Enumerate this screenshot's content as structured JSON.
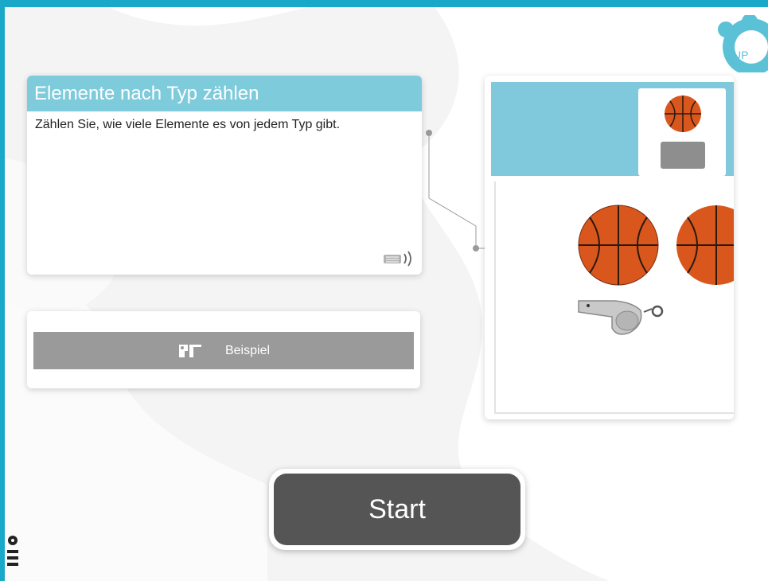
{
  "task": {
    "title": "Elemente nach Typ zählen",
    "description": "Zählen Sie, wie viele Elemente es von jedem Typ gibt."
  },
  "example_button": {
    "label": "Beispiel"
  },
  "start_button": {
    "label": "Start"
  },
  "brand_logo": {
    "text": "UP"
  },
  "colors": {
    "frame": "#1aa8c8",
    "title_bar": "#7ecbdc",
    "example_button": "#9a9a9a",
    "start_button": "#555555",
    "ball": "#d9571c"
  },
  "icons": {
    "audio": "speaker-icon",
    "example": "example-icon",
    "logo": "up-logo",
    "menu": "menu-icon"
  }
}
